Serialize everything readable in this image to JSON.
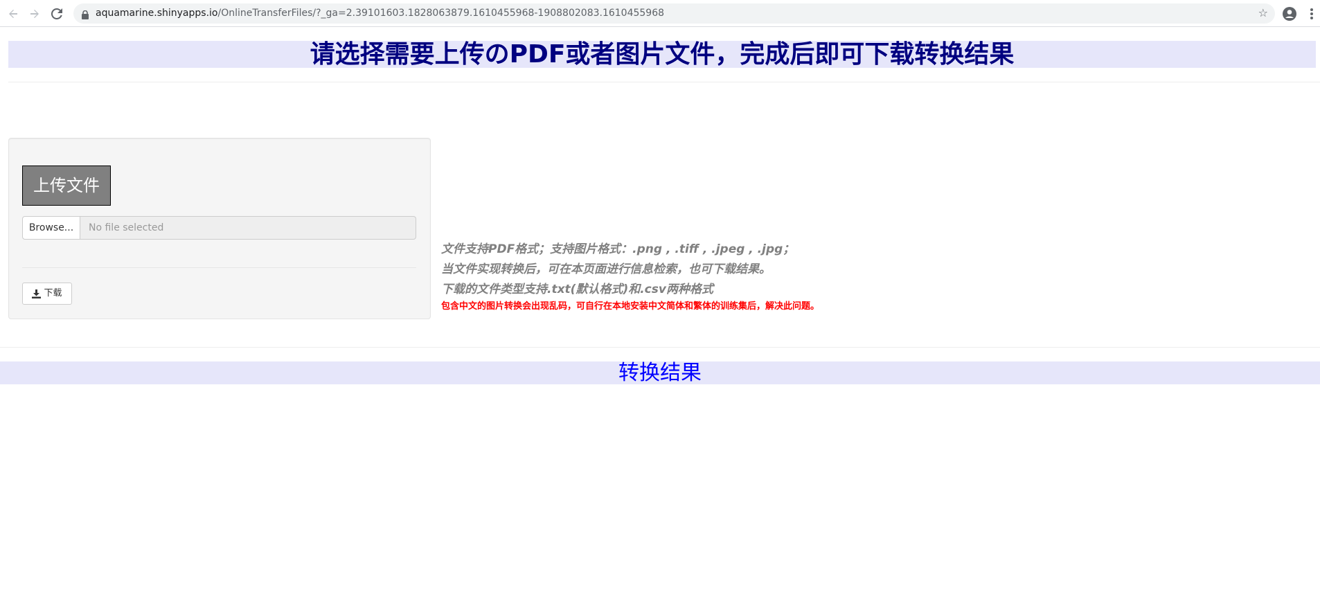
{
  "browser": {
    "url_host": "aquamarine.shinyapps.io",
    "url_path": "/OnlineTransferFiles/?_ga=2.39101603.1828063879.1610455968-1908802083.1610455968"
  },
  "page": {
    "title": "请选择需要上传のPDF或者图片文件，完成后即可下载转换结果",
    "result_title": "转换结果"
  },
  "upload_panel": {
    "upload_label": "上传文件",
    "browse_label": "Browse...",
    "file_placeholder": "No file selected",
    "download_label": "下载"
  },
  "info": {
    "line1": "文件支持PDF格式；支持图片格式：.png , .tiff , .jpeg , .jpg；",
    "line2": "当文件实现转换后，可在本页面进行信息检索，也可下载结果。",
    "line3": "下载的文件类型支持.txt(默认格式)和.csv两种格式",
    "warning": "包含中文的图片转换会出现乱码，可自行在本地安装中文简体和繁体的训练集后，解决此问题。"
  },
  "colors": {
    "title_bg": "#e6e6fa",
    "title_text": "#000080",
    "result_text": "#0000ff",
    "warning_text": "#ff0000",
    "upload_bg": "#808080"
  },
  "icons": {
    "back": "arrow-left-icon",
    "forward": "arrow-right-icon",
    "reload": "reload-icon",
    "lock": "lock-icon",
    "bookmark": "star-icon",
    "account": "account-icon",
    "menu": "kebab-menu-icon",
    "download": "download-icon"
  }
}
